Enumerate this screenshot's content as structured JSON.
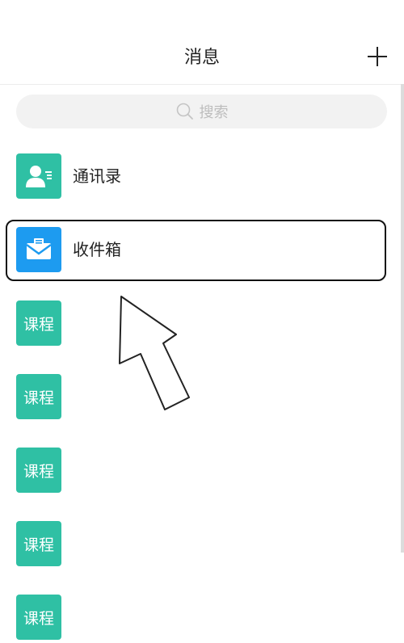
{
  "header": {
    "title": "消息",
    "add_icon": "plus-icon"
  },
  "search": {
    "placeholder": "搜索",
    "icon": "search-icon"
  },
  "items": [
    {
      "label": "通讯录",
      "icon": "contacts-icon",
      "color": "#2fc0a4"
    },
    {
      "label": "收件箱",
      "icon": "inbox-mail-icon",
      "color": "#1d9bf0"
    }
  ],
  "courses": [
    {
      "label": "课程"
    },
    {
      "label": "课程"
    },
    {
      "label": "课程"
    },
    {
      "label": "课程"
    },
    {
      "label": "课程"
    }
  ],
  "colors": {
    "course": "#2fc0a4",
    "contacts": "#2fc0a4",
    "inbox": "#1d9bf0",
    "highlight_border": "#111111"
  }
}
